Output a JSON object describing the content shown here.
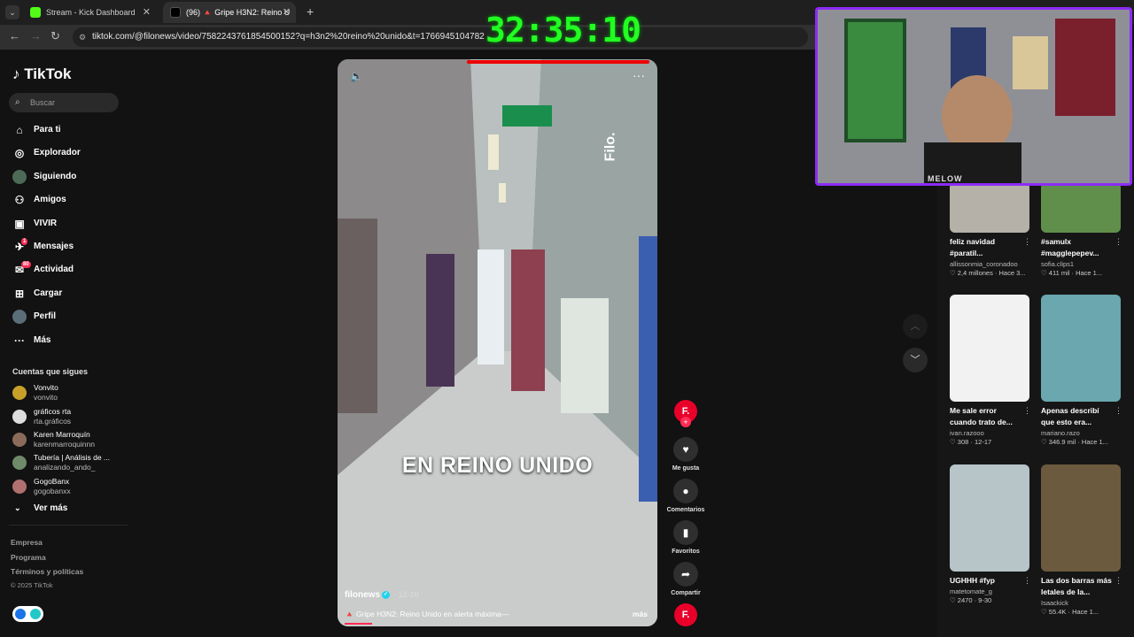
{
  "browser": {
    "tabs": [
      {
        "title": "Stream - Kick Dashboard",
        "active": false
      },
      {
        "title": "(96) 🔺 Gripe H3N2: Reino U",
        "active": true
      }
    ],
    "url": "tiktok.com/@filonews/video/7582243761854500152?q=h3n2%20reino%20unido&t=1766945104782"
  },
  "overlay": {
    "timer": "32:35:10",
    "webcam_label": "MELOW"
  },
  "sidebar": {
    "logo": "TikTok",
    "search_placeholder": "Buscar",
    "nav": [
      {
        "label": "Para ti",
        "icon": "home-icon"
      },
      {
        "label": "Explorador",
        "icon": "compass-icon"
      },
      {
        "label": "Siguiendo",
        "icon": "following-icon"
      },
      {
        "label": "Amigos",
        "icon": "friends-icon"
      },
      {
        "label": "VIVIR",
        "icon": "live-icon"
      },
      {
        "label": "Mensajes",
        "icon": "messages-icon",
        "badge": "1"
      },
      {
        "label": "Actividad",
        "icon": "activity-icon",
        "badge": "80"
      },
      {
        "label": "Cargar",
        "icon": "upload-icon"
      },
      {
        "label": "Perfil",
        "icon": "profile-icon"
      },
      {
        "label": "Más",
        "icon": "more-icon"
      }
    ],
    "following_title": "Cuentas que sigues",
    "following": [
      {
        "name": "Vonvito",
        "handle": "vonvito",
        "color": "#c7a02a"
      },
      {
        "name": "gráficos rta",
        "handle": "rta.gráficos",
        "color": "#ddd"
      },
      {
        "name": "Karen Marroquín",
        "handle": "karenmarroquinnn",
        "color": "#8a6b5a"
      },
      {
        "name": "Tubería | Análisis de ...",
        "handle": "analizando_ando_",
        "color": "#6f8a6a"
      },
      {
        "name": "GogoBanx",
        "handle": "gogobanxx",
        "color": "#b07070"
      }
    ],
    "ver_mas": "Ver más",
    "footer": [
      "Empresa",
      "Programa",
      "Términos y políticas"
    ],
    "copyright": "© 2025 TikTok"
  },
  "video": {
    "caption_overlay": "EN REINO UNIDO",
    "watermark": "Filo.",
    "author": "filonews",
    "date": "· 12-10",
    "description": "🔺 Gripe H3N2: Reino Unido en alerta máxima—",
    "more_label": "más",
    "progress": 0.09
  },
  "actions": {
    "avatar_letter": "F.",
    "like_label": "Me gusta",
    "comments_label": "Comentarios",
    "favorites_label": "Favoritos",
    "share_label": "Compartir"
  },
  "recommended": [
    {
      "title": "feliz navidad #paratil...",
      "user": "allissonmia_coronadoo",
      "stats": "♡ 2,4 millones · Hace 3...",
      "thumb": "#b5b0a8"
    },
    {
      "title": "#samulx #magglepepev...",
      "user": "sofia.clips1",
      "stats": "♡ 411 mil · Hace 1...",
      "thumb": "#5f8f4a"
    },
    {
      "title": "Me sale error cuando trato de...",
      "user": "ivan.razooo",
      "stats": "♡ 308 · 12-17",
      "thumb": "#f2f2f2"
    },
    {
      "title": "Apenas describí que esto era...",
      "user": "mariano.razo",
      "stats": "♡ 346.9 mil · Hace 1...",
      "thumb": "#6aa7ae"
    },
    {
      "title": "UGHHH #fyp",
      "user": "matetomate_g",
      "stats": "♡ 2470 · 9-30",
      "thumb": "#b7c4c8"
    },
    {
      "title": "Las dos barras más letales de la...",
      "user": "Isaackick",
      "stats": "♡ 55.4K · Hace 1...",
      "thumb": "#6b5a3e"
    }
  ],
  "colors": {
    "accent": "#fe2c55",
    "timer": "#22ff22",
    "webcam_border": "#8b2cf5"
  }
}
